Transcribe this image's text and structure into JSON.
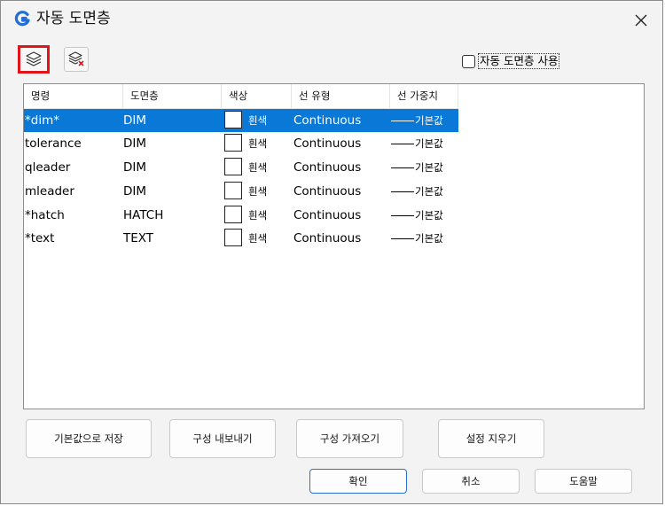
{
  "window": {
    "title": "자동 도면층"
  },
  "toolbar": {
    "auto_layer_checkbox_label": "자동 도면층 사용",
    "auto_layer_checked": false
  },
  "table": {
    "headers": [
      "명령",
      "도면층",
      "색상",
      "선 유형",
      "선 가중치"
    ],
    "rows": [
      {
        "command": "*dim*",
        "layer": "DIM",
        "color": "흰색",
        "linetype": "Continuous",
        "lineweight": "기본값",
        "selected": true
      },
      {
        "command": "tolerance",
        "layer": "DIM",
        "color": "흰색",
        "linetype": "Continuous",
        "lineweight": "기본값",
        "selected": false
      },
      {
        "command": "qleader",
        "layer": "DIM",
        "color": "흰색",
        "linetype": "Continuous",
        "lineweight": "기본값",
        "selected": false
      },
      {
        "command": "mleader",
        "layer": "DIM",
        "color": "흰색",
        "linetype": "Continuous",
        "lineweight": "기본값",
        "selected": false
      },
      {
        "command": "*hatch",
        "layer": "HATCH",
        "color": "흰색",
        "linetype": "Continuous",
        "lineweight": "기본값",
        "selected": false
      },
      {
        "command": "*text",
        "layer": "TEXT",
        "color": "흰색",
        "linetype": "Continuous",
        "lineweight": "기본값",
        "selected": false
      }
    ]
  },
  "actions": {
    "save_default": "기본값으로 저장",
    "export_config": "구성 내보내기",
    "import_config": "구성 가져오기",
    "clear_settings": "설정 지우기"
  },
  "footer": {
    "ok": "확인",
    "cancel": "취소",
    "help": "도움말"
  },
  "colors": {
    "selection": "#0a78d7",
    "highlight_border": "#e0151b",
    "app_icon": "#1f6fd6"
  },
  "icons": {
    "app": "gstarcad-logo-icon",
    "add_layer": "layer-stack-icon",
    "delete_layer": "layer-delete-icon",
    "close": "close-icon"
  }
}
